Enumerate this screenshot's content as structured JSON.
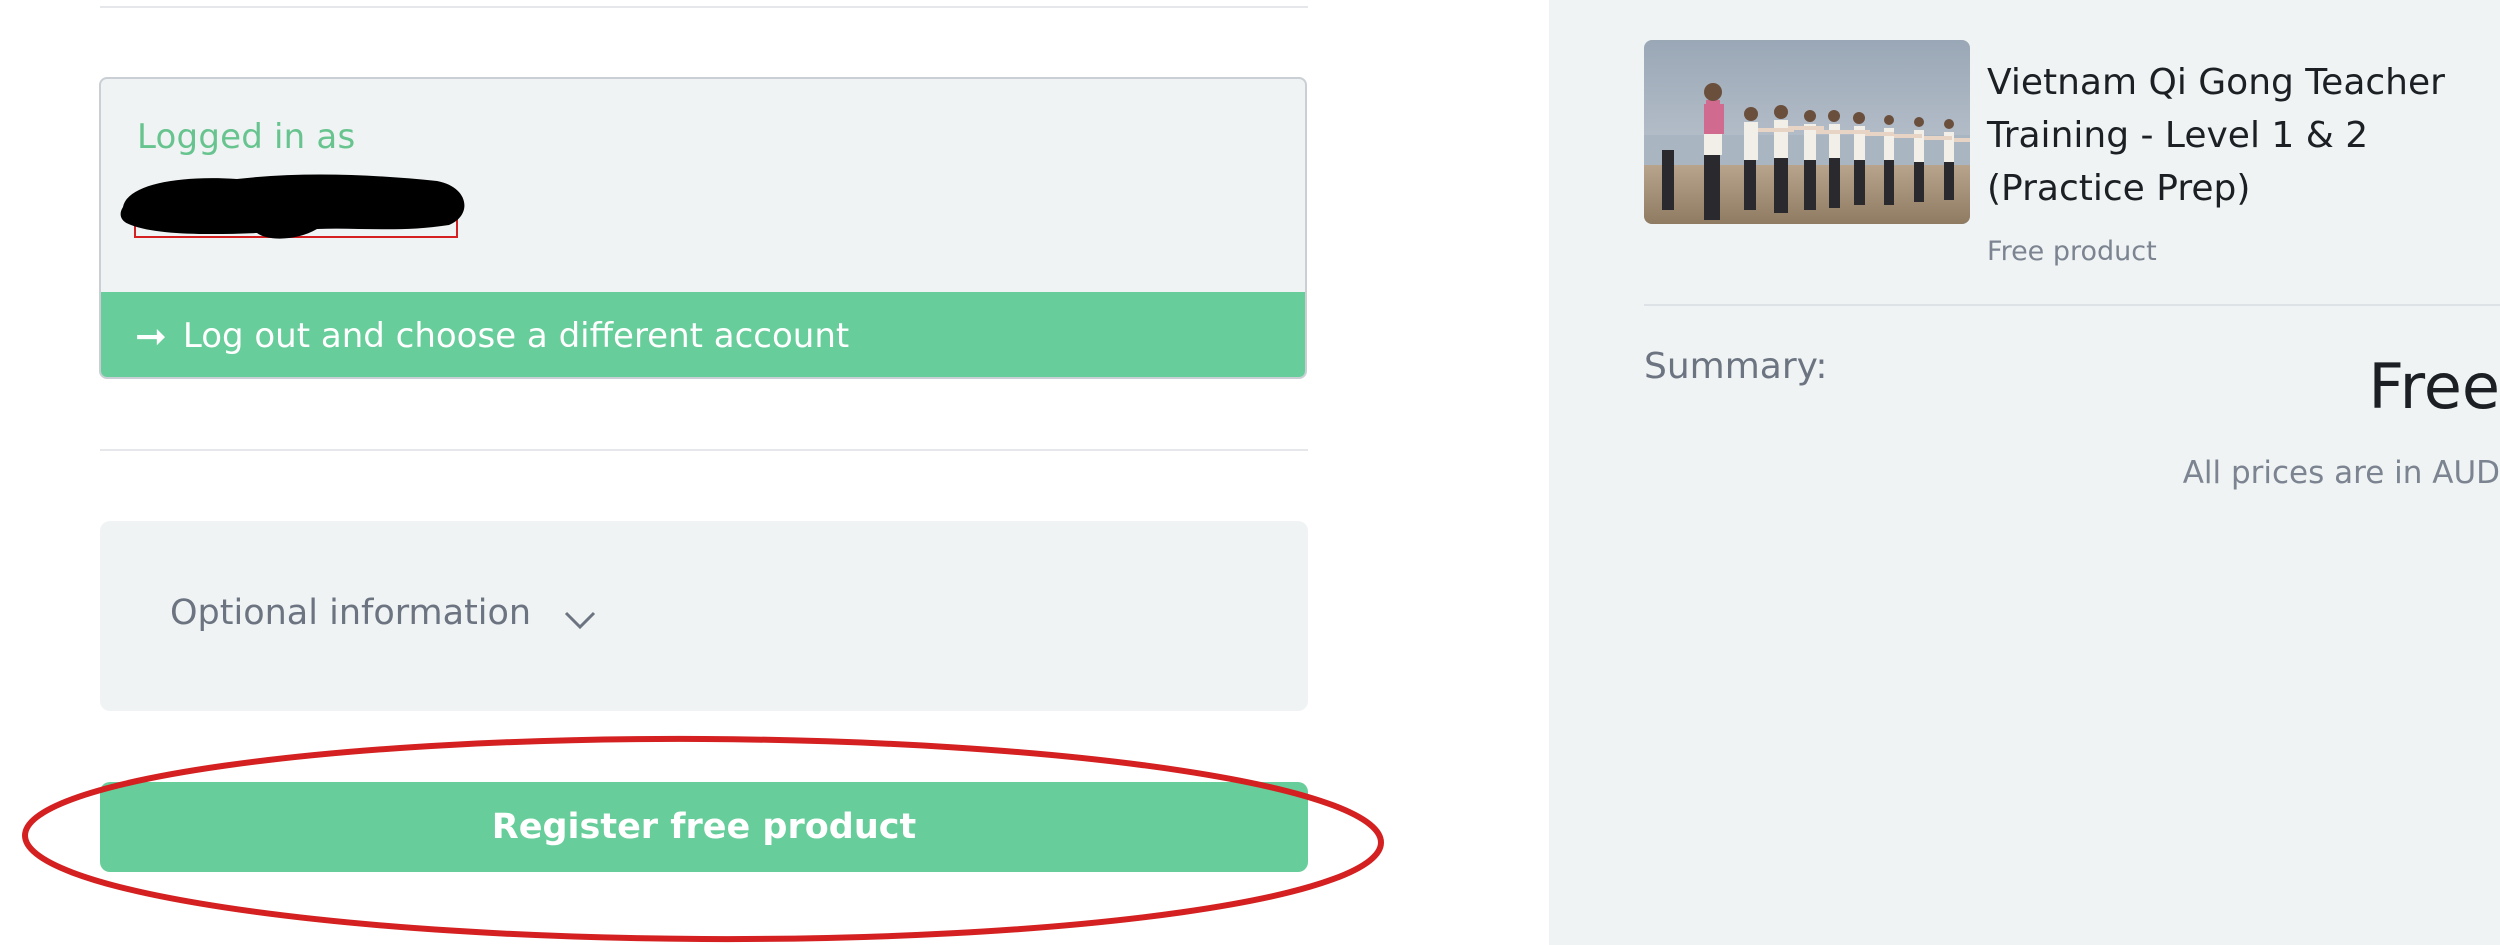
{
  "account": {
    "logged_in_label": "Logged in as",
    "logout_label": "Log out and choose a different account"
  },
  "optional": {
    "label": "Optional information"
  },
  "register": {
    "label": "Register free product"
  },
  "product": {
    "title": "Vietnam Qi Gong Teacher Training - Level 1 & 2 (Practice Prep)",
    "subtitle": "Free product"
  },
  "summary": {
    "label": "Summary:",
    "value": "Free",
    "currency_note": "All prices are in AUD"
  },
  "icons": {
    "logout": "arrow-right-icon",
    "optional_toggle": "chevron-down-icon"
  },
  "colors": {
    "accent": "#67cd9a",
    "accent_text": "#67c48f",
    "panel_bg": "#f0f3f4",
    "annotation": "#d42020"
  }
}
